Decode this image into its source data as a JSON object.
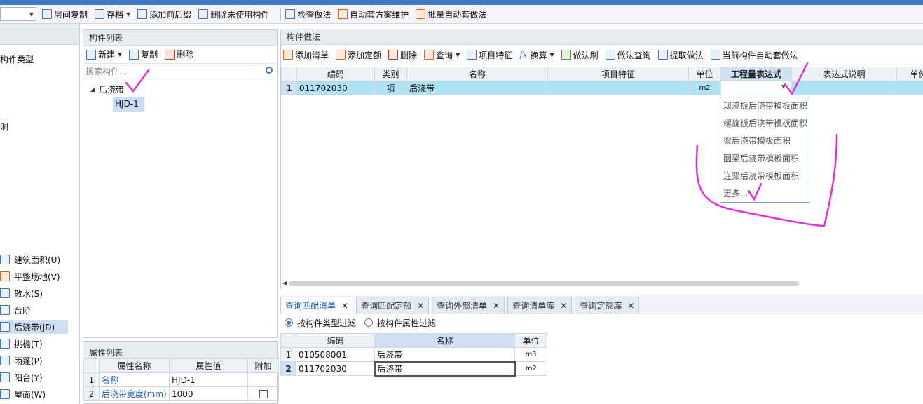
{
  "toolbar": {
    "items": [
      {
        "label": "层间复制",
        "icon": "layer-copy-icon"
      },
      {
        "label": "存档",
        "icon": "archive-icon"
      },
      {
        "label": "添加前后缀",
        "icon": "prefix-suffix-icon"
      },
      {
        "label": "删除未使用构件",
        "icon": "delete-unused-icon"
      },
      {
        "label": "检查做法",
        "icon": "check-method-icon"
      },
      {
        "label": "自动套方案维护",
        "icon": "auto-scheme-icon"
      },
      {
        "label": "批量自动套做法",
        "icon": "batch-auto-icon"
      }
    ]
  },
  "left": {
    "header": "构件类型",
    "partial": [
      "洞"
    ],
    "items": [
      {
        "label": "建筑面积(U)",
        "icon": "area-icon"
      },
      {
        "label": "平整场地(V)",
        "icon": "leveling-icon"
      },
      {
        "label": "散水(S)",
        "icon": "apron-icon"
      },
      {
        "label": "台阶(",
        "icon": "step-icon",
        "label_full": "台阶"
      },
      {
        "label": "后浇带(JD)",
        "icon": "post-pour-strip-icon"
      },
      {
        "label": "挑檐(T)",
        "icon": "eave-icon"
      },
      {
        "label": "雨蓬(P)",
        "icon": "canopy-icon"
      },
      {
        "label": "阳台(Y)",
        "icon": "balcony-icon"
      },
      {
        "label": "屋面(W)",
        "icon": "roof-icon"
      }
    ]
  },
  "complist": {
    "title": "构件列表",
    "tools": [
      "新建",
      "复制",
      "删除"
    ],
    "search_placeholder": "搜索构件...",
    "tree": {
      "parent": "后浇带",
      "child": "HJD-1"
    }
  },
  "attrlist": {
    "title": "属性列表",
    "headers": [
      "属性名称",
      "属性值",
      "附加"
    ],
    "rows": [
      {
        "n": "1",
        "name": "名称",
        "value": "HJD-1"
      },
      {
        "n": "2",
        "name": "后浇带宽度(mm)",
        "value": "1000"
      }
    ]
  },
  "method": {
    "title": "构件做法",
    "tools": [
      "添加清单",
      "添加定额",
      "删除",
      "查询",
      "项目特征",
      "换算",
      "做法刷",
      "做法查询",
      "提取做法",
      "当前构件自动套做法"
    ],
    "headers": [
      "编码",
      "类别",
      "名称",
      "项目特征",
      "单位",
      "工程量表达式",
      "表达式说明",
      "单价"
    ],
    "row": {
      "n": "1",
      "code": "011702030",
      "type": "项",
      "name": "后浇带",
      "feature": "",
      "unit": "m2",
      "expr": "",
      "desc": ""
    }
  },
  "dropdown": {
    "options": [
      "现浇板后浇带模板面积",
      "螺旋板后浇带模板面积",
      "梁后浇带模板面积",
      "圈梁后浇带模板面积",
      "连梁后浇带模板面积",
      "更多..."
    ]
  },
  "bottom": {
    "tabs": [
      "查询匹配清单",
      "查询匹配定额",
      "查询外部清单",
      "查询清单库",
      "查询定额库"
    ],
    "close": "✕",
    "filters": [
      "按构件类型过滤",
      "按构件属性过滤"
    ],
    "headers": [
      "编码",
      "名称",
      "单位"
    ],
    "rows": [
      {
        "n": "1",
        "code": "010508001",
        "name": "后浇带",
        "unit": "m3"
      },
      {
        "n": "2",
        "code": "011702030",
        "name": "后浇带",
        "unit": "m2"
      }
    ]
  },
  "colors": {
    "accent": "#3d78c4",
    "selected_row": "#aee4f5",
    "annotation": "#e62fd8"
  }
}
